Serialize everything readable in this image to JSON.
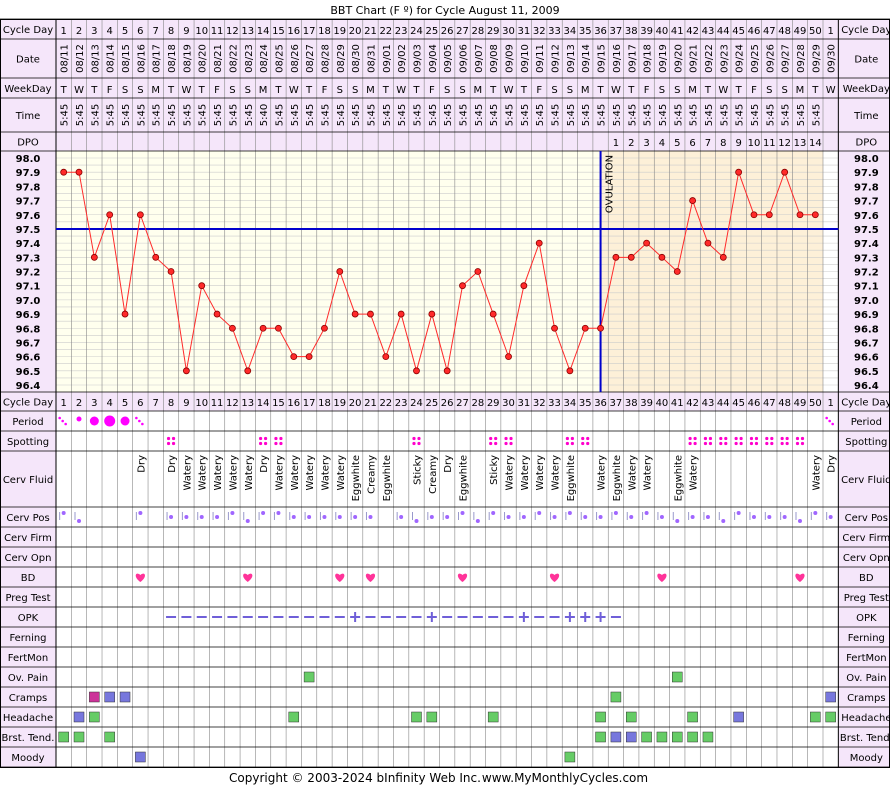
{
  "title": "BBT Chart (F º) for Cycle August 11, 2009",
  "copyright": "Copyright © 2003-2024 bInfinity Web Inc.",
  "site": "www.MyMonthlyCycles.com",
  "row_labels": [
    "Cycle Day",
    "Date",
    "WeekDay",
    "Time",
    "DPO",
    "Cycle Day",
    "Period",
    "Spotting",
    "Cerv Fluid",
    "Cerv Pos",
    "Cerv Firm",
    "Cerv Opn",
    "BD",
    "Preg Test",
    "OPK",
    "Ferning",
    "FertMon",
    "Ov. Pain",
    "Cramps",
    "Headache",
    "Brst. Tend.",
    "Moody"
  ],
  "cycle_days": [
    "1",
    "2",
    "3",
    "4",
    "5",
    "6",
    "7",
    "8",
    "9",
    "10",
    "11",
    "12",
    "13",
    "14",
    "15",
    "16",
    "17",
    "18",
    "19",
    "20",
    "21",
    "22",
    "23",
    "24",
    "25",
    "26",
    "27",
    "28",
    "29",
    "30",
    "31",
    "32",
    "33",
    "34",
    "35",
    "36",
    "37",
    "38",
    "39",
    "40",
    "41",
    "42",
    "43",
    "44",
    "45",
    "46",
    "47",
    "48",
    "49",
    "50",
    "1"
  ],
  "dates": [
    "08/11",
    "08/12",
    "08/13",
    "08/14",
    "08/15",
    "08/16",
    "08/17",
    "08/18",
    "08/19",
    "08/20",
    "08/21",
    "08/22",
    "08/23",
    "08/24",
    "08/25",
    "08/26",
    "08/27",
    "08/28",
    "08/29",
    "08/30",
    "08/31",
    "09/01",
    "09/02",
    "09/03",
    "09/04",
    "09/05",
    "09/06",
    "09/07",
    "09/08",
    "09/09",
    "09/10",
    "09/11",
    "09/12",
    "09/13",
    "09/14",
    "09/15",
    "09/16",
    "09/17",
    "09/18",
    "09/19",
    "09/20",
    "09/21",
    "09/22",
    "09/23",
    "09/24",
    "09/25",
    "09/26",
    "09/27",
    "09/28",
    "09/29",
    "09/30"
  ],
  "weekdays": [
    "T",
    "W",
    "T",
    "F",
    "S",
    "S",
    "M",
    "T",
    "W",
    "T",
    "F",
    "S",
    "S",
    "M",
    "T",
    "W",
    "T",
    "F",
    "S",
    "S",
    "M",
    "T",
    "W",
    "T",
    "F",
    "S",
    "S",
    "M",
    "T",
    "W",
    "T",
    "F",
    "S",
    "S",
    "M",
    "T",
    "W",
    "T",
    "F",
    "S",
    "S",
    "M",
    "T",
    "W",
    "T",
    "F",
    "S",
    "S",
    "M",
    "T",
    "W"
  ],
  "times": [
    "5:45",
    "5:45",
    "5:45",
    "5:45",
    "5:45",
    "5:45",
    "5:45",
    "5:45",
    "5:45",
    "5:45",
    "5:45",
    "5:45",
    "5:45",
    "5:40",
    "5:45",
    "5:45",
    "5:45",
    "5:45",
    "5:45",
    "5:45",
    "5:45",
    "5:45",
    "5:45",
    "5:45",
    "5:45",
    "5:45",
    "5:45",
    "5:45",
    "5:45",
    "5:45",
    "5:45",
    "5:45",
    "5:45",
    "5:45",
    "5:45",
    "5:45",
    "5:45",
    "5:45",
    "5:45",
    "5:45",
    "5:45",
    "5:45",
    "5:45",
    "5:45",
    "5:45",
    "5:45",
    "5:45",
    "5:45",
    "5:45",
    "5:45",
    ""
  ],
  "dpo": [
    "",
    "",
    "",
    "",
    "",
    "",
    "",
    "",
    "",
    "",
    "",
    "",
    "",
    "",
    "",
    "",
    "",
    "",
    "",
    "",
    "",
    "",
    "",
    "",
    "",
    "",
    "",
    "",
    "",
    "",
    "",
    "",
    "",
    "",
    "",
    "",
    "1",
    "2",
    "3",
    "4",
    "5",
    "6",
    "7",
    "8",
    "9",
    "10",
    "11",
    "12",
    "13",
    "14",
    ""
  ],
  "temp_labels": [
    "98.0",
    "97.9",
    "97.8",
    "97.7",
    "97.6",
    "97.5",
    "97.4",
    "97.3",
    "97.2",
    "97.1",
    "97.0",
    "96.9",
    "96.8",
    "96.7",
    "96.6",
    "96.5",
    "96.4"
  ],
  "ovulation_label": "OVULATION",
  "chart_data": {
    "type": "line",
    "x": [
      1,
      2,
      3,
      4,
      5,
      6,
      7,
      8,
      9,
      10,
      11,
      12,
      13,
      14,
      15,
      16,
      17,
      18,
      19,
      20,
      21,
      22,
      23,
      24,
      25,
      26,
      27,
      28,
      29,
      30,
      31,
      32,
      33,
      34,
      35,
      36,
      37,
      38,
      39,
      40,
      41,
      42,
      43,
      44,
      45,
      46,
      47,
      48,
      49,
      50
    ],
    "values": [
      97.9,
      97.9,
      97.3,
      97.6,
      96.9,
      97.6,
      97.3,
      97.2,
      96.5,
      97.1,
      96.9,
      96.8,
      96.5,
      96.8,
      96.8,
      96.6,
      96.6,
      96.8,
      97.2,
      96.9,
      96.9,
      96.6,
      96.9,
      96.5,
      96.9,
      96.5,
      97.1,
      97.2,
      96.9,
      96.6,
      97.1,
      97.4,
      96.8,
      96.5,
      96.8,
      96.8,
      97.3,
      97.3,
      97.4,
      97.3,
      97.2,
      97.7,
      97.4,
      97.3,
      97.9,
      97.6,
      97.6,
      97.9,
      97.6,
      97.6
    ],
    "ylim": [
      96.4,
      98.0
    ],
    "coverline": 97.5,
    "ovulation_day": 36,
    "line_color": "#ff2a2a",
    "coverline_color": "#0000cc",
    "pre_bg": "#ffffee",
    "post_bg": "#fdf0d8"
  },
  "colors": {
    "header_bg": "#f5e6fa",
    "period_color": "#ff00ff",
    "spot_color": "#ff00cc",
    "heart_color": "#ff3399",
    "opk_color": "#6f5fd8",
    "cervpos_color": "#a066ff",
    "green": "#66cc66",
    "blue": "#7777dd",
    "magenta": "#cc3399"
  },
  "period": [
    [
      1,
      "light"
    ],
    [
      2,
      "dot"
    ],
    [
      3,
      "medium"
    ],
    [
      4,
      "heavy"
    ],
    [
      5,
      "medium"
    ],
    [
      6,
      "light"
    ],
    [
      51,
      "light"
    ]
  ],
  "spotting_days": [
    8,
    14,
    15,
    24,
    29,
    30,
    34,
    35,
    42,
    43,
    44,
    45,
    46,
    47,
    48,
    49
  ],
  "cerv_fluid": [
    [
      6,
      "Dry"
    ],
    [
      8,
      "Dry"
    ],
    [
      9,
      "Watery"
    ],
    [
      10,
      "Watery"
    ],
    [
      11,
      "Watery"
    ],
    [
      12,
      "Watery"
    ],
    [
      13,
      "Watery"
    ],
    [
      14,
      "Dry"
    ],
    [
      15,
      "Watery"
    ],
    [
      16,
      "Watery"
    ],
    [
      17,
      "Watery"
    ],
    [
      18,
      "Watery"
    ],
    [
      19,
      "Watery"
    ],
    [
      20,
      "Eggwhite"
    ],
    [
      21,
      "Creamy"
    ],
    [
      22,
      "Eggwhite"
    ],
    [
      24,
      "Sticky"
    ],
    [
      25,
      "Creamy"
    ],
    [
      26,
      "Dry"
    ],
    [
      27,
      "Eggwhite"
    ],
    [
      29,
      "Sticky"
    ],
    [
      30,
      "Watery"
    ],
    [
      31,
      "Watery"
    ],
    [
      32,
      "Watery"
    ],
    [
      33,
      "Watery"
    ],
    [
      34,
      "Eggwhite"
    ],
    [
      36,
      "Watery"
    ],
    [
      37,
      "Eggwhite"
    ],
    [
      38,
      "Watery"
    ],
    [
      39,
      "Watery"
    ],
    [
      41,
      "Eggwhite"
    ],
    [
      42,
      "Watery"
    ],
    [
      50,
      "Watery"
    ],
    [
      51,
      "Dry"
    ]
  ],
  "cerv_pos_days": [
    [
      1,
      "high"
    ],
    [
      2,
      "low"
    ],
    [
      6,
      "high"
    ],
    [
      8,
      "mid"
    ],
    [
      9,
      "mid"
    ],
    [
      10,
      "mid"
    ],
    [
      11,
      "mid"
    ],
    [
      12,
      "high"
    ],
    [
      13,
      "low"
    ],
    [
      14,
      "high"
    ],
    [
      15,
      "high"
    ],
    [
      16,
      "mid"
    ],
    [
      17,
      "mid"
    ],
    [
      18,
      "mid"
    ],
    [
      19,
      "mid"
    ],
    [
      20,
      "mid"
    ],
    [
      21,
      "mid"
    ],
    [
      23,
      "mid"
    ],
    [
      24,
      "low"
    ],
    [
      25,
      "mid"
    ],
    [
      26,
      "mid"
    ],
    [
      27,
      "high"
    ],
    [
      28,
      "low"
    ],
    [
      29,
      "high"
    ],
    [
      30,
      "mid"
    ],
    [
      31,
      "mid"
    ],
    [
      32,
      "high"
    ],
    [
      33,
      "mid"
    ],
    [
      34,
      "high"
    ],
    [
      35,
      "mid"
    ],
    [
      36,
      "mid"
    ],
    [
      37,
      "high"
    ],
    [
      38,
      "mid"
    ],
    [
      39,
      "high"
    ],
    [
      40,
      "mid"
    ],
    [
      41,
      "low"
    ],
    [
      42,
      "mid"
    ],
    [
      43,
      "mid"
    ],
    [
      44,
      "low"
    ],
    [
      45,
      "high"
    ],
    [
      46,
      "mid"
    ],
    [
      47,
      "mid"
    ],
    [
      48,
      "mid"
    ],
    [
      49,
      "low"
    ],
    [
      50,
      "high"
    ],
    [
      51,
      "mid"
    ]
  ],
  "bd_days": [
    6,
    13,
    19,
    21,
    27,
    33,
    40,
    49
  ],
  "opk": [
    [
      8,
      "-"
    ],
    [
      9,
      "-"
    ],
    [
      10,
      "-"
    ],
    [
      11,
      "-"
    ],
    [
      12,
      "-"
    ],
    [
      13,
      "-"
    ],
    [
      14,
      "-"
    ],
    [
      15,
      "-"
    ],
    [
      16,
      "-"
    ],
    [
      17,
      "-"
    ],
    [
      18,
      "-"
    ],
    [
      19,
      "-"
    ],
    [
      20,
      "+"
    ],
    [
      21,
      "-"
    ],
    [
      22,
      "-"
    ],
    [
      23,
      "-"
    ],
    [
      24,
      "-"
    ],
    [
      25,
      "+"
    ],
    [
      26,
      "-"
    ],
    [
      27,
      "-"
    ],
    [
      28,
      "-"
    ],
    [
      29,
      "-"
    ],
    [
      30,
      "-"
    ],
    [
      31,
      "+"
    ],
    [
      32,
      "-"
    ],
    [
      33,
      "-"
    ],
    [
      34,
      "+"
    ],
    [
      35,
      "+"
    ],
    [
      36,
      "+"
    ],
    [
      37,
      "-"
    ]
  ],
  "ov_pain": [
    [
      17,
      "green"
    ],
    [
      41,
      "green"
    ]
  ],
  "cramps": [
    [
      3,
      "magenta"
    ],
    [
      4,
      "blue"
    ],
    [
      5,
      "blue"
    ],
    [
      37,
      "green"
    ],
    [
      51,
      "blue"
    ]
  ],
  "headache": [
    [
      2,
      "blue"
    ],
    [
      3,
      "green"
    ],
    [
      16,
      "green"
    ],
    [
      24,
      "green"
    ],
    [
      25,
      "green"
    ],
    [
      29,
      "green"
    ],
    [
      36,
      "green"
    ],
    [
      38,
      "green"
    ],
    [
      42,
      "green"
    ],
    [
      45,
      "blue"
    ],
    [
      50,
      "green"
    ],
    [
      51,
      "green"
    ]
  ],
  "brst_tend": [
    [
      1,
      "green"
    ],
    [
      2,
      "green"
    ],
    [
      4,
      "green"
    ],
    [
      36,
      "green"
    ],
    [
      37,
      "blue"
    ],
    [
      38,
      "blue"
    ],
    [
      39,
      "green"
    ],
    [
      40,
      "green"
    ],
    [
      41,
      "green"
    ],
    [
      42,
      "green"
    ],
    [
      43,
      "green"
    ]
  ],
  "moody": [
    [
      6,
      "blue"
    ],
    [
      34,
      "green"
    ]
  ]
}
